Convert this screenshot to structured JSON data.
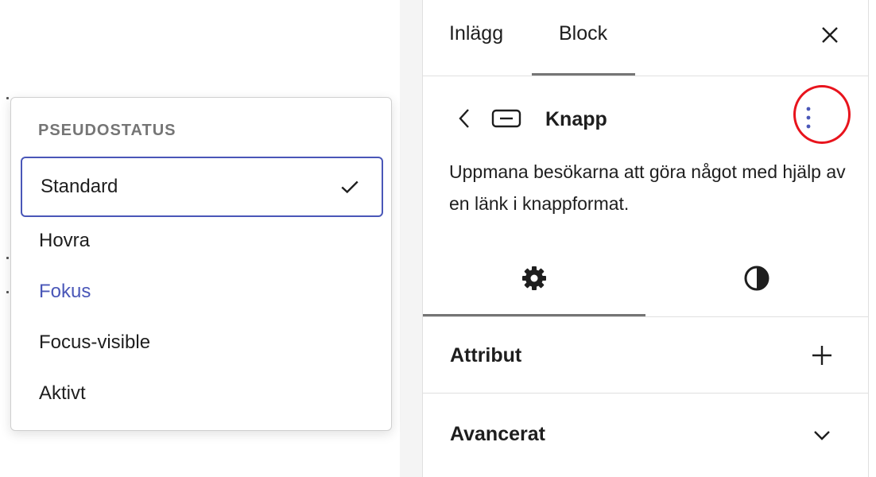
{
  "popover": {
    "heading": "PSEUDOSTATUS",
    "items": [
      {
        "label": "Standard",
        "selected": true
      },
      {
        "label": "Hovra"
      },
      {
        "label": "Fokus",
        "accent": true
      },
      {
        "label": "Focus-visible"
      },
      {
        "label": "Aktivt"
      }
    ]
  },
  "sidebar": {
    "tabs": [
      {
        "label": "Inlägg"
      },
      {
        "label": "Block",
        "active": true
      }
    ],
    "block": {
      "title": "Knapp",
      "description": "Uppmana besökarna att göra något med hjälp av en länk i knappformat."
    },
    "panels": [
      {
        "title": "Attribut"
      },
      {
        "title": "Avancerat"
      }
    ]
  },
  "colors": {
    "accent": "#4a57b8",
    "highlight_ring": "#e8141d",
    "text": "#1e1e1e",
    "muted": "#757575"
  }
}
